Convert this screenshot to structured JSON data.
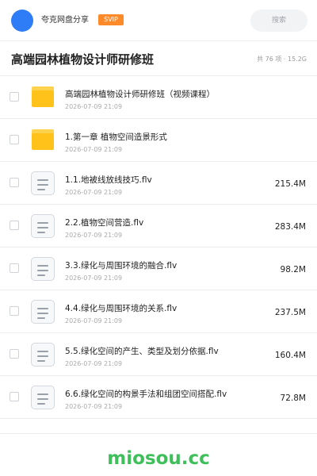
{
  "header": {
    "username": "夸克网盘分享",
    "badge": "SVIP",
    "search_placeholder": "搜索"
  },
  "folder": {
    "title": "高端园林植物设计师研修班",
    "stats": "共 76 项 · 15.2G"
  },
  "files": [
    {
      "type": "folder",
      "name": "高端园林植物设计师研修班（视频课程）",
      "date": "2026-07-09 21:09",
      "size": ""
    },
    {
      "type": "folder",
      "name": "1.第一章 植物空间造景形式",
      "date": "2026-07-09 21:09",
      "size": ""
    },
    {
      "type": "file",
      "name": "1.1.地被线放线技巧.flv",
      "date": "2026-07-09 21:09",
      "size": "215.4M"
    },
    {
      "type": "file",
      "name": "2.2.植物空间营造.flv",
      "date": "2026-07-09 21:09",
      "size": "283.4M"
    },
    {
      "type": "file",
      "name": "3.3.绿化与周围环境的融合.flv",
      "date": "2026-07-09 21:09",
      "size": "98.2M"
    },
    {
      "type": "file",
      "name": "4.4.绿化与周围环境的关系.flv",
      "date": "2026-07-09 21:09",
      "size": "237.5M"
    },
    {
      "type": "file",
      "name": "5.5.绿化空间的产生、类型及划分依据.flv",
      "date": "2026-07-09 21:09",
      "size": "160.4M"
    },
    {
      "type": "file",
      "name": "6.6.绿化空间的构景手法和组团空间搭配.flv",
      "date": "2026-07-09 21:09",
      "size": "72.8M"
    }
  ],
  "watermark": "miosou.cc",
  "colors": {
    "avatar": "#2f7df6",
    "badge": "#ff8a2a",
    "folder": "#ffc21a",
    "watermark": "#3fbf5a"
  }
}
